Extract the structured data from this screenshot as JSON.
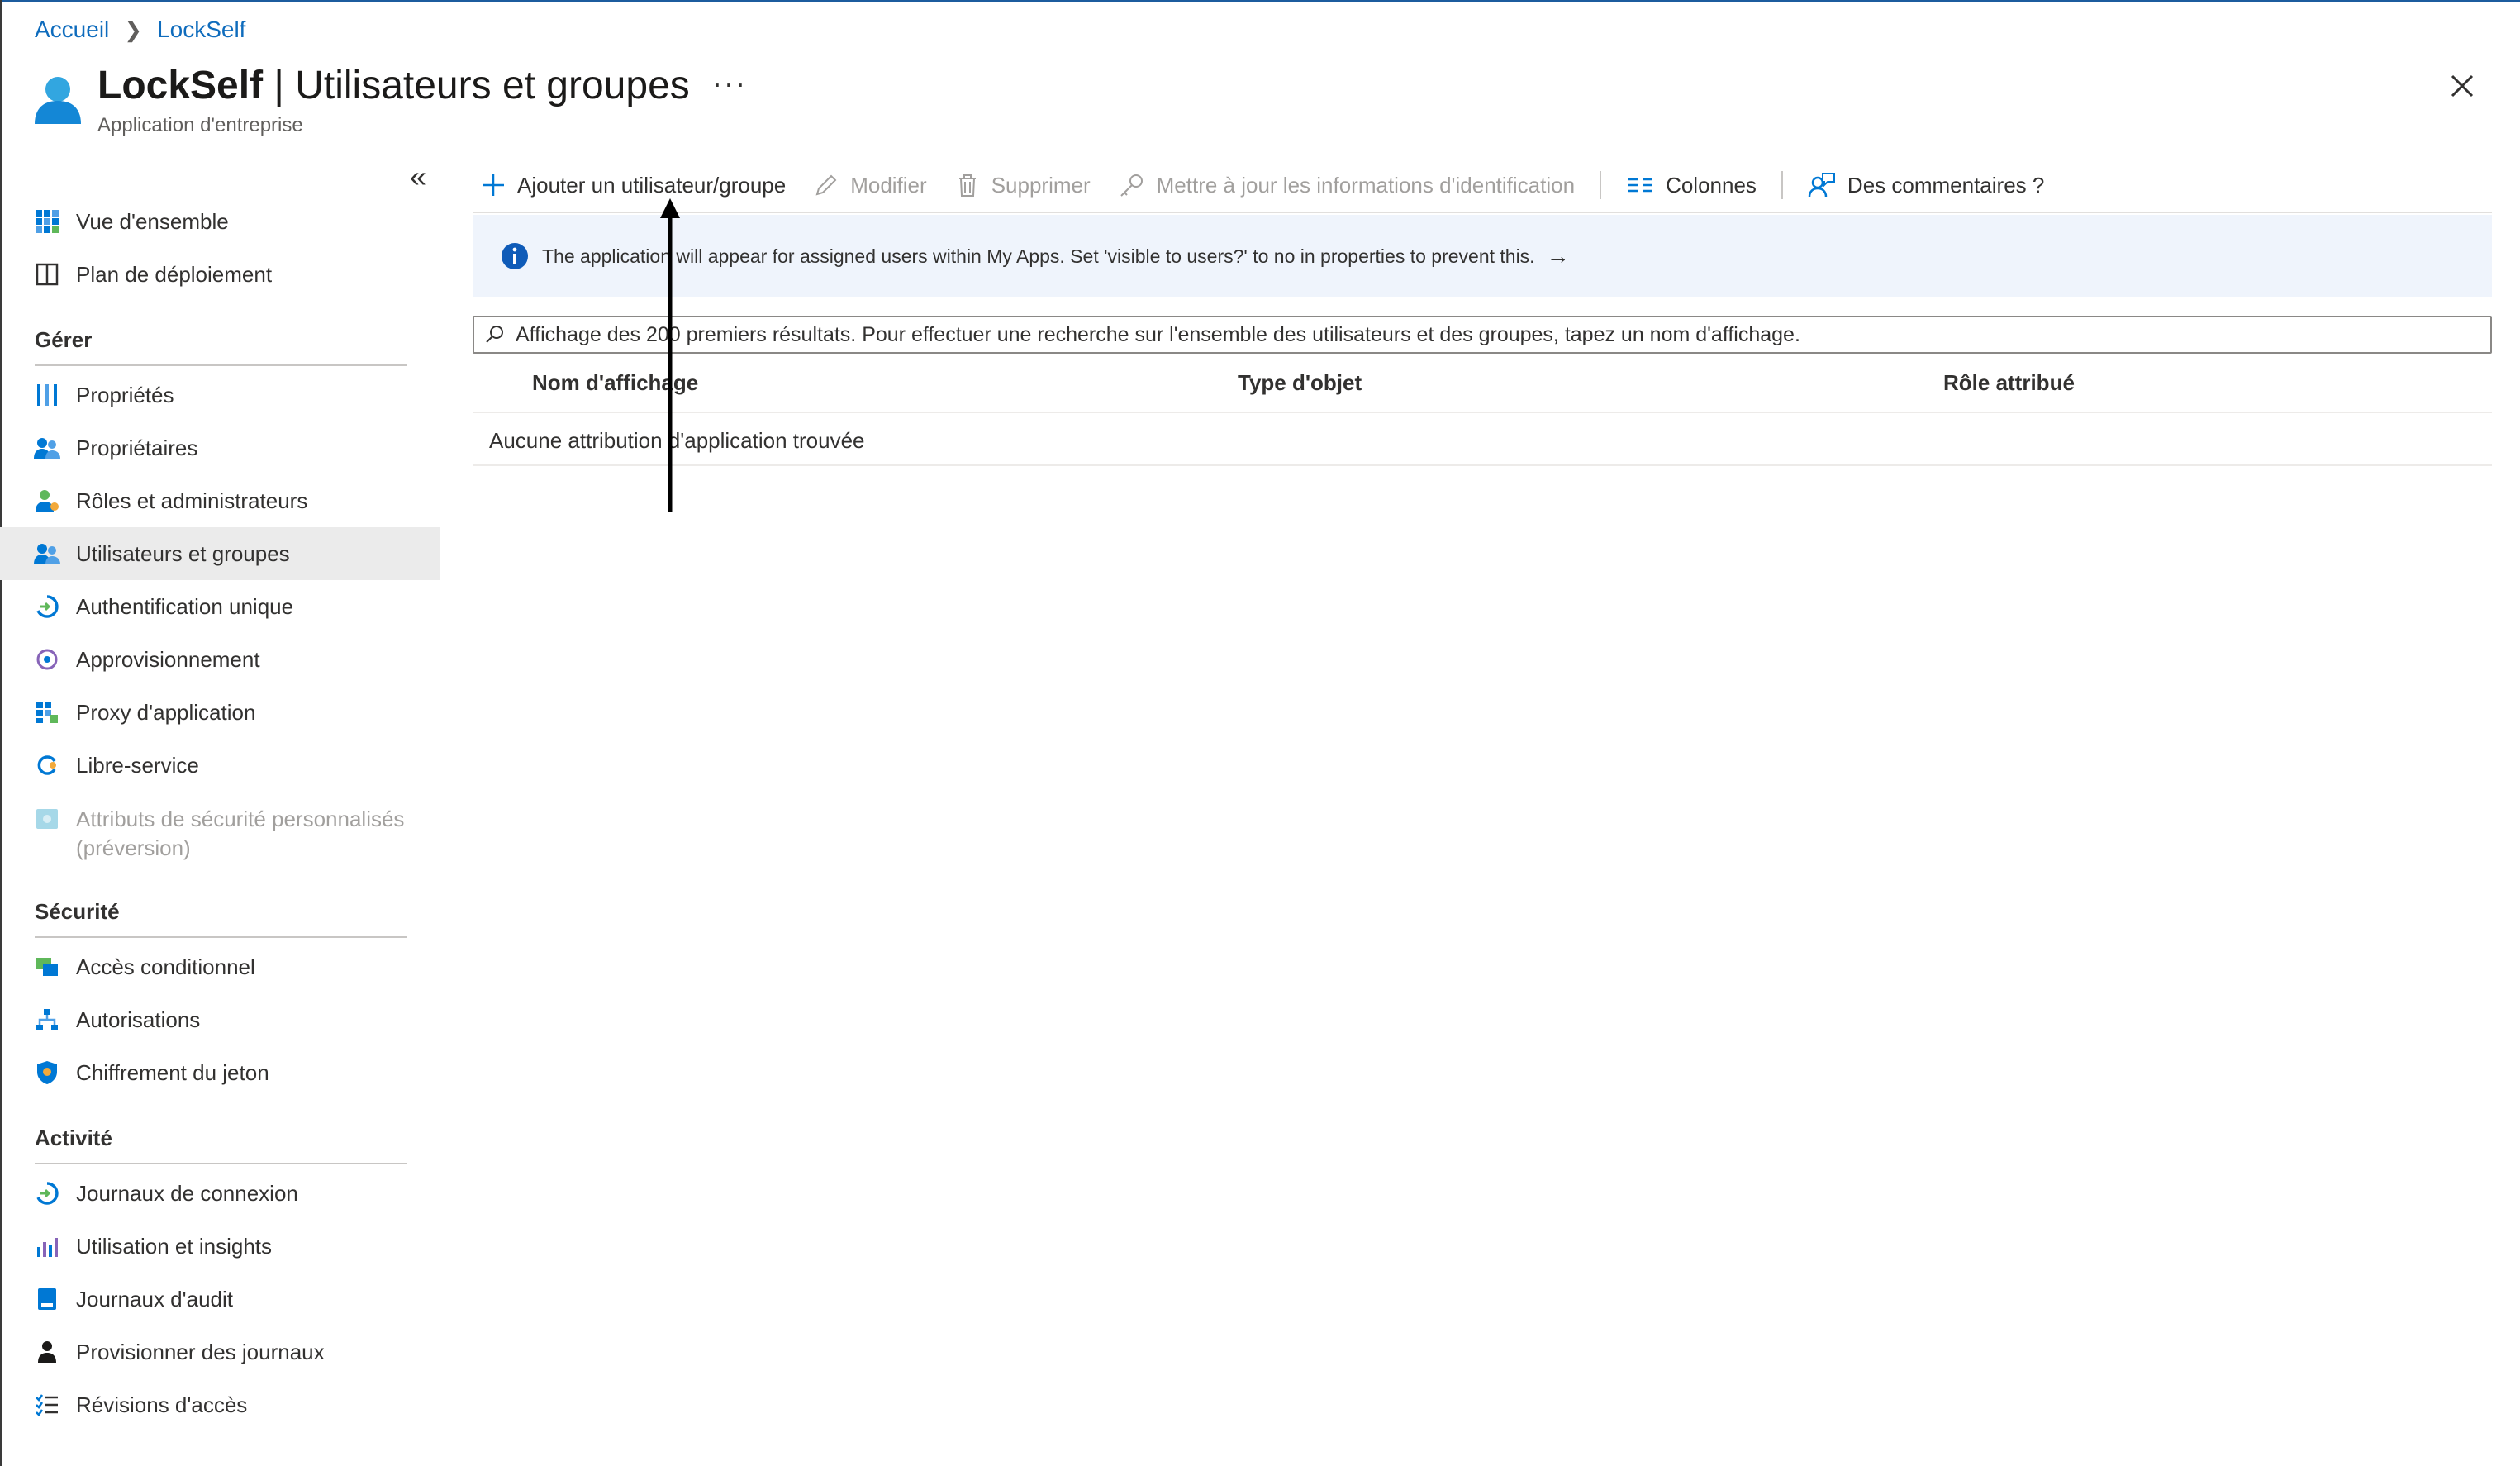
{
  "breadcrumb": {
    "home": "Accueil",
    "current": "LockSelf"
  },
  "header": {
    "title_bold": "LockSelf",
    "title_rest": " | Utilisateurs et groupes",
    "more": "···",
    "subtitle": "Application d'entreprise",
    "icon": "enterprise-app-user-icon",
    "close_icon": "close-icon"
  },
  "sidebar": {
    "collapse_label": "«",
    "top_items": [
      {
        "label": "Vue d'ensemble",
        "icon": "grid-icon"
      },
      {
        "label": "Plan de déploiement",
        "icon": "book-icon"
      }
    ],
    "sections": [
      {
        "title": "Gérer",
        "items": [
          {
            "label": "Propriétés",
            "icon": "sliders-icon"
          },
          {
            "label": "Propriétaires",
            "icon": "owners-icon"
          },
          {
            "label": "Rôles et administrateurs",
            "icon": "roles-icon"
          },
          {
            "label": "Utilisateurs et groupes",
            "icon": "users-groups-icon",
            "active": true
          },
          {
            "label": "Authentification unique",
            "icon": "sso-icon"
          },
          {
            "label": "Approvisionnement",
            "icon": "provisioning-icon"
          },
          {
            "label": "Proxy d'application",
            "icon": "app-proxy-icon"
          },
          {
            "label": "Libre-service",
            "icon": "self-service-icon"
          },
          {
            "label": "Attributs de sécurité personnalisés",
            "label2": "(préversion)",
            "icon": "security-attributes-icon",
            "muted": true
          }
        ]
      },
      {
        "title": "Sécurité",
        "items": [
          {
            "label": "Accès conditionnel",
            "icon": "conditional-access-icon"
          },
          {
            "label": "Autorisations",
            "icon": "permissions-icon"
          },
          {
            "label": "Chiffrement du jeton",
            "icon": "shield-icon"
          }
        ]
      },
      {
        "title": "Activité",
        "items": [
          {
            "label": "Journaux de connexion",
            "icon": "sign-in-logs-icon"
          },
          {
            "label": "Utilisation et insights",
            "icon": "bar-chart-icon"
          },
          {
            "label": "Journaux d'audit",
            "icon": "audit-log-icon"
          },
          {
            "label": "Provisionner des journaux",
            "icon": "provisioning-logs-icon"
          },
          {
            "label": "Révisions d'accès",
            "icon": "checklist-icon"
          }
        ]
      }
    ]
  },
  "toolbar": {
    "add": "Ajouter un utilisateur/groupe",
    "edit": "Modifier",
    "delete": "Supprimer",
    "update_credentials": "Mettre à jour les informations d'identification",
    "columns": "Colonnes",
    "feedback": "Des commentaires ?"
  },
  "banner": {
    "text": "The application will appear for assigned users within My Apps. Set 'visible to users?' to no in properties to prevent this.",
    "arrow": "→"
  },
  "search": {
    "placeholder": "Affichage des 200 premiers résultats. Pour effectuer une recherche sur l'ensemble des utilisateurs et des groupes, tapez un nom d'affichage."
  },
  "table": {
    "columns": [
      "Nom d'affichage",
      "Type d'objet",
      "Rôle attribué"
    ],
    "empty_message": "Aucune attribution d'application trouvée"
  },
  "colors": {
    "link": "#0f6cbd",
    "accent": "#0078d4",
    "active_bg": "#ebebeb",
    "banner_bg": "#eff4fc"
  }
}
